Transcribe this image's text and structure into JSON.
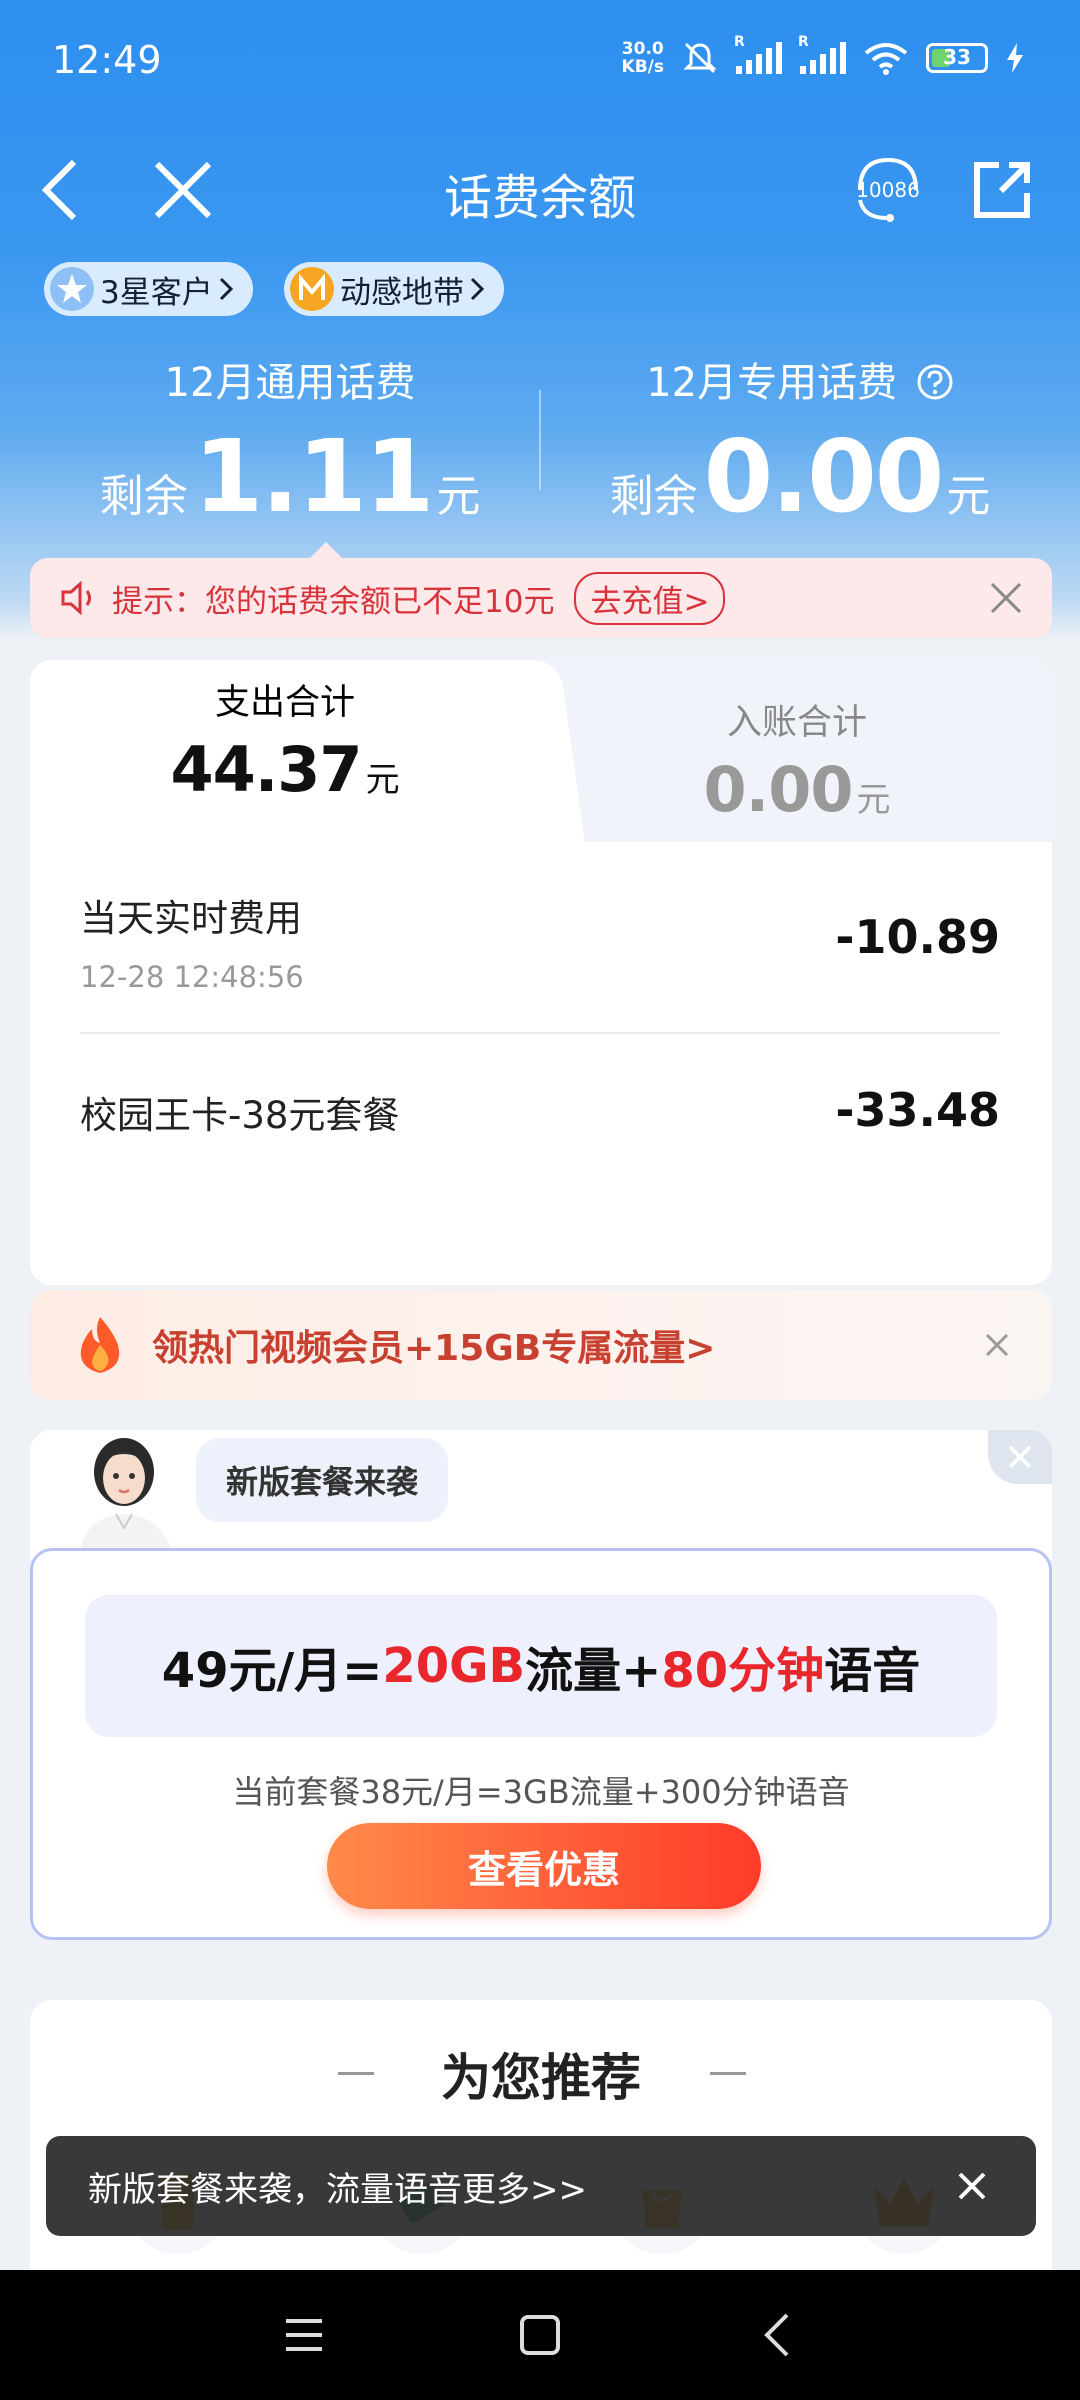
{
  "status_bar": {
    "time": "12:49",
    "net_speed_value": "30.0",
    "net_speed_unit": "KB/s",
    "sim1_label": "R",
    "sim2_label": "R",
    "battery": "33",
    "icons": [
      "mute-icon",
      "signal-icon",
      "signal-icon",
      "wifi-icon",
      "battery-icon",
      "charging-icon"
    ]
  },
  "header": {
    "title": "话费余额",
    "service_number": "10086"
  },
  "badges": [
    {
      "label": "3星客户",
      "icon": "star-icon"
    },
    {
      "label": "动感地带",
      "icon": "m-zone-icon"
    }
  ],
  "balance": {
    "general": {
      "label": "12月通用话费",
      "prefix": "剩余",
      "amount": "1.11",
      "unit": "元"
    },
    "special": {
      "label": "12月专用话费",
      "prefix": "剩余",
      "amount": "0.00",
      "unit": "元"
    }
  },
  "tip": {
    "text": "提示：您的话费余额已不足10元",
    "action": "去充值>"
  },
  "summary": {
    "expense": {
      "label": "支出合计",
      "amount": "44.37",
      "unit": "元"
    },
    "income": {
      "label": "入账合计",
      "amount": "0.00",
      "unit": "元"
    },
    "items": [
      {
        "name": "当天实时费用",
        "time": "12-28 12:48:56",
        "amount": "-10.89"
      },
      {
        "name": "校园王卡-38元套餐",
        "time": "",
        "amount": "-33.48"
      }
    ]
  },
  "promo": {
    "text": "领热门视频会员+15GB专属流量>"
  },
  "package": {
    "bubble": "新版套餐来袭",
    "offer_part1": "49元/月=",
    "offer_part2": "20GB",
    "offer_part3": "流量+",
    "offer_part4": "80分钟",
    "offer_part5": "语音",
    "current": "当前套餐38元/月=3GB流量+300分钟语音",
    "cta": "查看优惠"
  },
  "recommend": {
    "title": "为您推荐"
  },
  "toast": {
    "text": "新版套餐来袭，流量语音更多>>"
  },
  "colors": {
    "brand_blue": "#2e8ff0",
    "alert_red": "#d8323a",
    "price_red": "#e8262b",
    "cta_orange": "#ff6a3a"
  }
}
